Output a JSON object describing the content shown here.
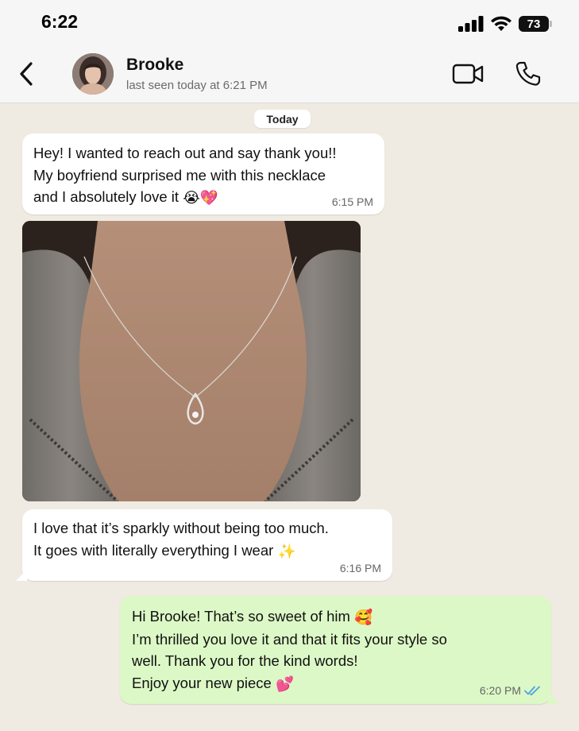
{
  "status_bar": {
    "time": "6:22",
    "battery": "73"
  },
  "header": {
    "contact_name": "Brooke",
    "last_seen": "last seen today at 6:21 PM",
    "icons": [
      "back-chevron-icon",
      "video-call-icon",
      "phone-call-icon"
    ]
  },
  "chat": {
    "date_label": "Today",
    "messages": [
      {
        "direction": "incoming",
        "text": "Hey! I wanted to reach out and say thank you!!\nMy boyfriend surprised me with this necklace\nand I absolutely love it",
        "emojis": [
          "😭",
          "💖"
        ],
        "time": "6:15 PM"
      },
      {
        "direction": "incoming",
        "type": "image",
        "image_description": "photo of a silver teardrop pendant necklace on a neck, gray zip hoodie"
      },
      {
        "direction": "incoming",
        "text": "I love that it’s sparkly without being too much.\nIt goes with literally everything I wear",
        "emojis": [
          "✨"
        ],
        "time": "6:16 PM"
      },
      {
        "direction": "outgoing",
        "line1": "Hi Brooke! That’s so sweet of him",
        "emoji1": "🥰",
        "text_mid": "I’m thrilled you love it and that it fits your style so\nwell. Thank you for the kind words!",
        "line_last": "Enjoy your new piece",
        "emoji2": "💕",
        "time": "6:20 PM",
        "read": true
      }
    ]
  },
  "colors": {
    "chat_bg": "#efeae2",
    "incoming_bubble": "#ffffff",
    "outgoing_bubble": "#dcf8c6",
    "read_ticks": "#4fa3e0"
  }
}
